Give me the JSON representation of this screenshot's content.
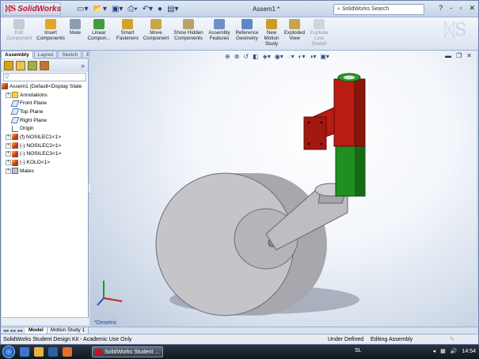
{
  "app": {
    "logo_text": "SolidWorks",
    "doc_title": "Assem1 *",
    "search_placeholder": "SolidWorks Search",
    "window_buttons": [
      "?",
      "-",
      "▫",
      "✕"
    ]
  },
  "ribbon": {
    "buttons": [
      {
        "label": "Edit Component",
        "enabled": false
      },
      {
        "label": "Insert Components",
        "enabled": true
      },
      {
        "label": "Mate",
        "enabled": true
      },
      {
        "label": "Linear Compon...",
        "enabled": true
      },
      {
        "label": "Smart Fasteners",
        "enabled": true
      },
      {
        "label": "Move Component",
        "enabled": true
      },
      {
        "label": "Show Hidden Components",
        "enabled": true
      },
      {
        "label": "Assembly Features",
        "enabled": true
      },
      {
        "label": "Reference Geometry",
        "enabled": true
      },
      {
        "label": "New Motion Study",
        "enabled": true
      },
      {
        "label": "Exploded View",
        "enabled": true
      },
      {
        "label": "Explode Line Sketch",
        "enabled": false
      }
    ]
  },
  "tabs": [
    "Assembly",
    "Layout",
    "Sketch",
    "Evaluate"
  ],
  "tree": {
    "root": "Assem1  (Default<Display State",
    "items": [
      {
        "label": "Annotations",
        "icon": "annotations-icon",
        "expand": "+"
      },
      {
        "label": "Front Plane",
        "icon": "plane-icon",
        "expand": ""
      },
      {
        "label": "Top Plane",
        "icon": "plane-icon",
        "expand": ""
      },
      {
        "label": "Right Plane",
        "icon": "plane-icon",
        "expand": ""
      },
      {
        "label": "Origin",
        "icon": "origin-icon",
        "expand": ""
      },
      {
        "label": "(f) NOSILEC1<1>",
        "icon": "part-icon",
        "expand": "+"
      },
      {
        "label": "(-) NOSILEC2<1>",
        "icon": "part-icon",
        "expand": "+"
      },
      {
        "label": "(-) NOSILEC3<1>",
        "icon": "part-icon",
        "expand": "+"
      },
      {
        "label": "(-) KOLO<1>",
        "icon": "part-icon",
        "expand": "+"
      },
      {
        "label": "Mates",
        "icon": "mates-icon",
        "expand": "+"
      }
    ]
  },
  "viewport": {
    "view_label": "*Dimetric",
    "colors": {
      "red": "#b81c12",
      "green": "#1f8f1f",
      "gray": "#c8c8cc"
    }
  },
  "bottom_tabs": [
    "Model",
    "Motion Study 1"
  ],
  "status": {
    "left": "SolidWorks Student Design Kit - Academic Use Only",
    "middle": "Under Defined",
    "right": "Editing Assembly"
  },
  "taskbar": {
    "task_label": "SolidWorks Student ...",
    "lang": "SL",
    "time": "14:54"
  }
}
